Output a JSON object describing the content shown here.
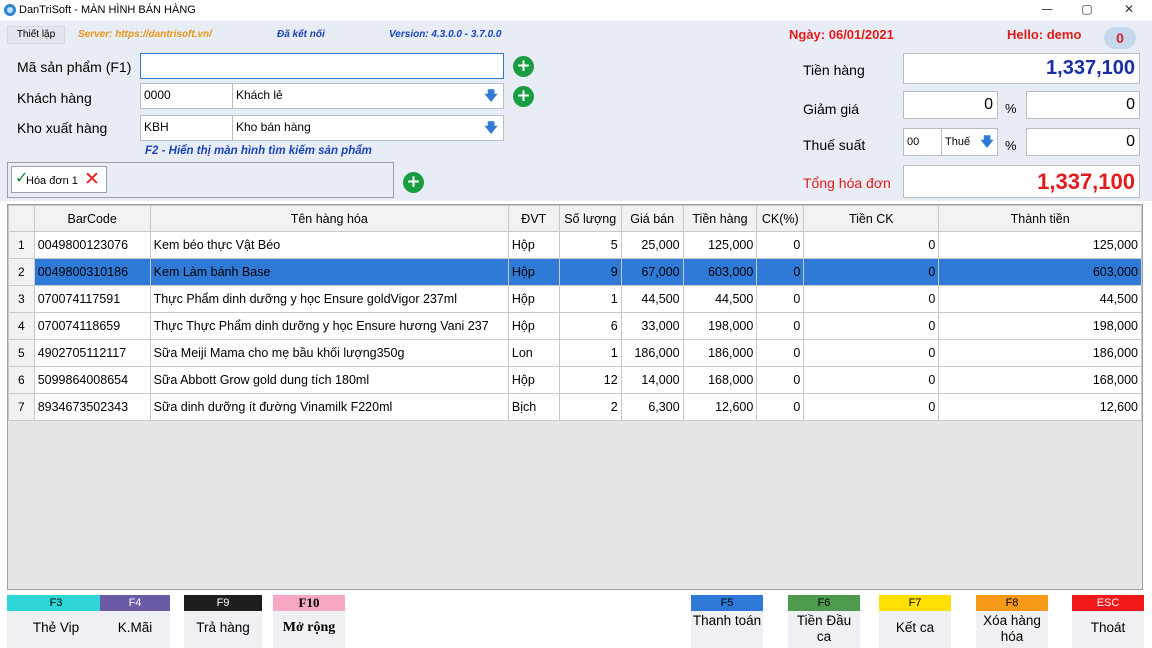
{
  "window": {
    "title": "DanTriSoft - MÀN HÌNH BÁN HÀNG",
    "controls": {
      "minimize": "—",
      "maximize": "▢",
      "close": "✕"
    }
  },
  "header": {
    "setup_tab": "Thiết lập",
    "server": "Server: https://dantrisoft.vn/",
    "connection": "Đã kết nối",
    "version": "Version: 4.3.0.0 - 3.7.0.0",
    "date": "Ngày: 06/01/2021",
    "hello": "Hello: demo",
    "badge": "0"
  },
  "form": {
    "product_label": "Mã sản phẩm (F1)",
    "product_value": "",
    "customer_label": "Khách hàng",
    "customer_code": "0000",
    "customer_name": "Khách lẻ",
    "warehouse_label": "Kho xuất hàng",
    "warehouse_code": "KBH",
    "warehouse_name": "Kho bán hàng",
    "hint": "F2 - Hiển thị màn hình tìm kiếm sản phẩm",
    "order_tab": "Hóa đơn 1"
  },
  "totals": {
    "goods_label": "Tiền hàng",
    "goods_value": "1,337,100",
    "discount_label": "Giảm giá",
    "discount_percent": "0",
    "discount_value": "0",
    "tax_label": "Thuế suất",
    "tax_code": "00",
    "tax_name": "Thuế",
    "percent_sign": "%",
    "tax_value": "0",
    "total_label": "Tổng hóa đơn",
    "total_value": "1,337,100"
  },
  "grid": {
    "columns": [
      "BarCode",
      "Tên hàng hóa",
      "ĐVT",
      "Số lượng",
      "Giá bán",
      "Tiền hàng",
      "CK(%)",
      "Tiền CK",
      "Thành tiền"
    ],
    "selected_row": 1,
    "rows": [
      [
        "1",
        "0049800123076",
        "Kem béo thực Vật Béo",
        "Hộp",
        "5",
        "25,000",
        "125,000",
        "0",
        "0",
        "125,000"
      ],
      [
        "2",
        "0049800310186",
        "Kem Làm bánh Base",
        "Hộp",
        "9",
        "67,000",
        "603,000",
        "0",
        "0",
        "603,000"
      ],
      [
        "3",
        "070074117591",
        "Thực Phẩm dinh dưỡng y học Ensure goldVigor 237ml",
        "Hộp",
        "1",
        "44,500",
        "44,500",
        "0",
        "0",
        "44,500"
      ],
      [
        "4",
        "070074118659",
        "Thực Thực Phẩm dinh dưỡng y học Ensure hương Vani 237",
        "Hộp",
        "6",
        "33,000",
        "198,000",
        "0",
        "0",
        "198,000"
      ],
      [
        "5",
        "4902705112117",
        "Sữa Meiji Mama cho mẹ bầu khối lượng350g",
        "Lon",
        "1",
        "186,000",
        "186,000",
        "0",
        "0",
        "186,000"
      ],
      [
        "6",
        "5099864008654",
        "Sữa Abbott Grow gold dung tích 180ml",
        "Hộp",
        "12",
        "14,000",
        "168,000",
        "0",
        "0",
        "168,000"
      ],
      [
        "7",
        "8934673502343",
        "Sữa dinh dưỡng ít đường Vinamilk F220ml",
        "Bịch",
        "2",
        "6,300",
        "12,600",
        "0",
        "0",
        "12,600"
      ]
    ]
  },
  "function_keys": [
    {
      "key": "F3",
      "label": "Thẻ Vip",
      "color": "#2fd6d6",
      "text_color": "#000000"
    },
    {
      "key": "F4",
      "label": "K.Mãi",
      "color": "#6b5aa6",
      "text_color": "#ffffff"
    },
    {
      "key": "F9",
      "label": "Trả hàng",
      "color": "#1e1e1e",
      "text_color": "#ffffff"
    },
    {
      "key": "F10",
      "label": "Mở rộng",
      "color": "#f7a8c5",
      "text_color": "#000000"
    },
    {
      "key": "F5",
      "label": "Thanh toán",
      "color": "#2f7ad6",
      "text_color": "#000000"
    },
    {
      "key": "F6",
      "label": "Tiền Đầu ca",
      "color": "#4e9a4e",
      "text_color": "#000000"
    },
    {
      "key": "F7",
      "label": "Kết ca",
      "color": "#ffe000",
      "text_color": "#000000"
    },
    {
      "key": "F8",
      "label": "Xóa hàng hóa",
      "color": "#f79a18",
      "text_color": "#000000"
    },
    {
      "key": "ESC",
      "label": "Thoát",
      "color": "#f01818",
      "text_color": "#ffffff"
    }
  ],
  "colors": {
    "accent_blue": "#2f7ad6",
    "header_bg": "#e7ecf5",
    "red": "#e31b1b",
    "green": "#1a9c41"
  }
}
